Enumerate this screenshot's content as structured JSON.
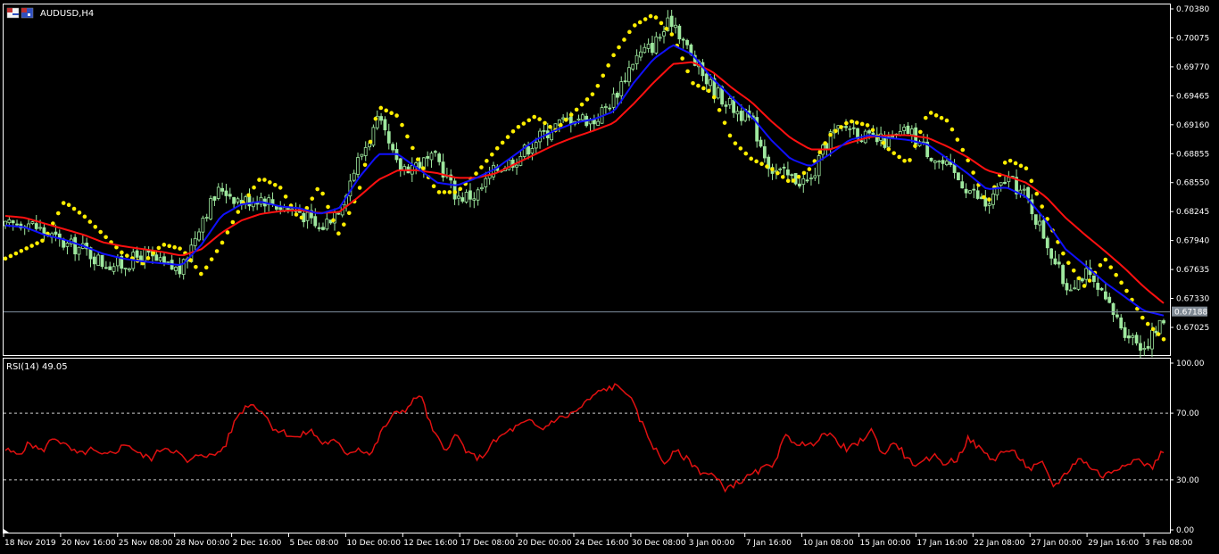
{
  "window": {
    "symbol_title": "AUDUSD,H4",
    "rsi_title": "RSI(14) 49.05",
    "current_price_label": "0.67188"
  },
  "colors": {
    "background": "#000000",
    "frame": "#ffffff",
    "candle": "#9ee89e",
    "ma_fast": "#1010ff",
    "ma_slow": "#ff1010",
    "psar": "#ffee00",
    "rsi": "#e01010",
    "level_line": "#ffffff",
    "price_line": "#7f8fa0",
    "price_badge": "#808a94"
  },
  "chart_data": [
    {
      "type": "candlestick",
      "symbol": "AUDUSD",
      "timeframe": "H4",
      "ylim": [
        0.6675,
        0.7038
      ],
      "y_ticks": [
        "0.70380",
        "0.70075",
        "0.69770",
        "0.69465",
        "0.69160",
        "0.68855",
        "0.68550",
        "0.68245",
        "0.67940",
        "0.67635",
        "0.67330",
        "0.67025"
      ],
      "x_ticks": [
        "18 Nov 2019",
        "20 Nov 16:00",
        "25 Nov 08:00",
        "28 Nov 00:00",
        "2 Dec 16:00",
        "5 Dec 08:00",
        "10 Dec 00:00",
        "12 Dec 16:00",
        "17 Dec 08:00",
        "20 Dec 00:00",
        "24 Dec 16:00",
        "30 Dec 08:00",
        "3 Jan 00:00",
        "7 Jan 16:00",
        "10 Jan 08:00",
        "15 Jan 00:00",
        "17 Jan 16:00",
        "22 Jan 08:00",
        "27 Jan 00:00",
        "29 Jan 16:00",
        "3 Feb 08:00"
      ],
      "current_price": 0.67188,
      "close_path": [
        0.6808,
        0.6815,
        0.6803,
        0.679,
        0.6785,
        0.677,
        0.6768,
        0.678,
        0.6768,
        0.6762,
        0.6818,
        0.685,
        0.6835,
        0.684,
        0.683,
        0.6825,
        0.6805,
        0.683,
        0.688,
        0.692,
        0.687,
        0.6875,
        0.688,
        0.684,
        0.6842,
        0.687,
        0.688,
        0.69,
        0.6915,
        0.6925,
        0.692,
        0.6945,
        0.6985,
        0.7,
        0.7028,
        0.6985,
        0.6955,
        0.6935,
        0.692,
        0.687,
        0.686,
        0.6855,
        0.6905,
        0.6915,
        0.69,
        0.6898,
        0.691,
        0.6888,
        0.687,
        0.685,
        0.683,
        0.686,
        0.684,
        0.6795,
        0.6745,
        0.676,
        0.673,
        0.67,
        0.6682,
        0.671
      ],
      "ma_fast": [
        0.681,
        0.6808,
        0.68,
        0.6795,
        0.6788,
        0.678,
        0.6775,
        0.6772,
        0.677,
        0.6768,
        0.679,
        0.682,
        0.6832,
        0.6835,
        0.683,
        0.6828,
        0.6822,
        0.6828,
        0.686,
        0.6885,
        0.6885,
        0.687,
        0.6855,
        0.6852,
        0.686,
        0.687,
        0.6885,
        0.69,
        0.691,
        0.6918,
        0.6922,
        0.693,
        0.696,
        0.6985,
        0.7,
        0.699,
        0.6965,
        0.6945,
        0.6925,
        0.69,
        0.688,
        0.6872,
        0.6885,
        0.69,
        0.6905,
        0.6902,
        0.69,
        0.6895,
        0.688,
        0.6865,
        0.6848,
        0.685,
        0.684,
        0.6815,
        0.6785,
        0.6768,
        0.675,
        0.6735,
        0.672,
        0.6715
      ],
      "ma_slow": [
        0.682,
        0.6818,
        0.6812,
        0.6806,
        0.68,
        0.6792,
        0.6788,
        0.6785,
        0.6782,
        0.6778,
        0.6785,
        0.6802,
        0.6815,
        0.6822,
        0.6825,
        0.6826,
        0.6823,
        0.6824,
        0.684,
        0.6858,
        0.6868,
        0.6868,
        0.6865,
        0.686,
        0.686,
        0.6865,
        0.6875,
        0.6885,
        0.6895,
        0.6903,
        0.691,
        0.6918,
        0.6938,
        0.696,
        0.698,
        0.6982,
        0.6972,
        0.6955,
        0.694,
        0.692,
        0.6902,
        0.689,
        0.689,
        0.6897,
        0.6903,
        0.6905,
        0.6905,
        0.6902,
        0.6893,
        0.6882,
        0.6868,
        0.6862,
        0.6855,
        0.684,
        0.6818,
        0.68,
        0.6783,
        0.6765,
        0.6745,
        0.6728
      ],
      "psar": [
        0.6775,
        0.6785,
        0.6795,
        0.6835,
        0.682,
        0.68,
        0.678,
        0.677,
        0.679,
        0.6785,
        0.6758,
        0.679,
        0.683,
        0.686,
        0.685,
        0.6815,
        0.6852,
        0.68,
        0.6845,
        0.6935,
        0.6925,
        0.688,
        0.6845,
        0.6845,
        0.6865,
        0.689,
        0.6912,
        0.6925,
        0.691,
        0.693,
        0.695,
        0.699,
        0.702,
        0.7032,
        0.701,
        0.696,
        0.695,
        0.69,
        0.688,
        0.687,
        0.6855,
        0.687,
        0.6905,
        0.692,
        0.6915,
        0.689,
        0.6875,
        0.693,
        0.692,
        0.688,
        0.6832,
        0.688,
        0.687,
        0.682,
        0.6775,
        0.6745,
        0.6775,
        0.6745,
        0.671,
        0.669
      ]
    },
    {
      "type": "line",
      "title": "RSI(14) 49.05",
      "ylim": [
        0,
        100
      ],
      "y_ticks": [
        "100.00",
        "70.00",
        "30.00",
        "0.00"
      ],
      "levels": [
        70,
        30
      ],
      "series": [
        {
          "values": [
            48,
            45,
            52,
            47,
            56,
            50,
            45,
            48,
            44,
            47,
            52,
            45,
            43,
            50,
            47,
            40,
            46,
            44,
            50,
            68,
            76,
            72,
            61,
            58,
            55,
            60,
            52,
            53,
            46,
            49,
            45,
            61,
            70,
            73,
            82,
            60,
            48,
            57,
            45,
            43,
            52,
            58,
            62,
            65,
            60,
            66,
            68,
            72,
            79,
            84,
            86,
            83,
            67,
            52,
            40,
            47,
            42,
            35,
            33,
            25,
            28,
            32,
            36,
            40,
            56,
            52,
            50,
            58,
            55,
            48,
            52,
            60,
            45,
            53,
            42,
            38,
            45,
            40,
            42,
            55,
            48,
            42,
            48,
            45,
            36,
            40,
            26,
            34,
            43,
            38,
            32,
            36,
            41,
            42,
            37,
            48
          ]
        }
      ]
    }
  ]
}
